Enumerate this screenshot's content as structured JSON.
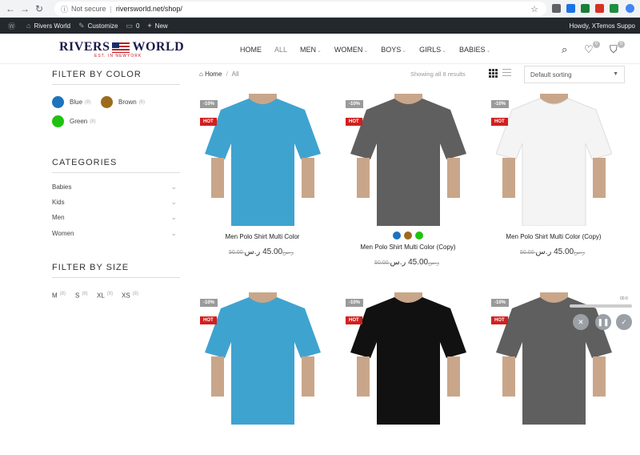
{
  "browser": {
    "not_secure": "Not secure",
    "url": "riversworld.net/shop/"
  },
  "wpbar": {
    "site": "Rivers World",
    "customize": "Customize",
    "comments": "0",
    "new": "New",
    "howdy": "Howdy, XTemos Suppo"
  },
  "header": {
    "logo_left": "RIVERS",
    "logo_right": "WORLD",
    "logo_sub": "EST. IN NEWYORK",
    "nav": [
      "HOME",
      "ALL",
      "MEN",
      "WOMEN",
      "BOYS",
      "GIRLS",
      "BABIES"
    ],
    "wishlist_count": "0",
    "cart_count": "0"
  },
  "sidebar": {
    "color_title": "FILTER BY COLOR",
    "colors": [
      {
        "name": "Blue",
        "count": "(8)",
        "hex": "#1e73be"
      },
      {
        "name": "Brown",
        "count": "(6)",
        "hex": "#9c6b1e"
      },
      {
        "name": "Green",
        "count": "(8)",
        "hex": "#20c20e"
      }
    ],
    "cat_title": "CATEGORIES",
    "categories": [
      "Babies",
      "Kids",
      "Men",
      "Women"
    ],
    "size_title": "FILTER BY SIZE",
    "sizes": [
      {
        "name": "M",
        "count": "(8)"
      },
      {
        "name": "S",
        "count": "(8)"
      },
      {
        "name": "XL",
        "count": "(8)"
      },
      {
        "name": "XS",
        "count": "(8)"
      }
    ]
  },
  "toolbar": {
    "home": "Home",
    "sep": "/",
    "current": "All",
    "showing": "Showing all 8 results",
    "sort": "Default sorting"
  },
  "products": [
    {
      "name": "Men Polo Shirt Multi Color",
      "sale": "-10%",
      "hot": "HOT",
      "old_price": "50.00 ر.س",
      "price": "45.00 ر.س",
      "shirt_color": "#3fa3d0",
      "swatches": []
    },
    {
      "name": "Men Polo Shirt Multi Color (Copy)",
      "sale": "-10%",
      "hot": "HOT",
      "old_price": "50.00 ر.س",
      "price": "45.00 ر.س",
      "shirt_color": "#5f5f5f",
      "swatches": [
        "#1e73be",
        "#9c6b1e",
        "#20c20e"
      ]
    },
    {
      "name": "Men Polo Shirt Multi Color (Copy)",
      "sale": "-10%",
      "hot": "HOT",
      "old_price": "50.00 ر.س",
      "price": "45.00 ر.س",
      "shirt_color": "#f4f4f4",
      "swatches": []
    },
    {
      "name": "",
      "sale": "-10%",
      "hot": "HOT",
      "old_price": "",
      "price": "",
      "shirt_color": "#3fa3d0",
      "swatches": []
    },
    {
      "name": "",
      "sale": "-10%",
      "hot": "HOT",
      "old_price": "",
      "price": "",
      "shirt_color": "#111111",
      "swatches": []
    },
    {
      "name": "",
      "sale": "-10%",
      "hot": "HOT",
      "old_price": "",
      "price": "",
      "shirt_color": "#5f5f5f",
      "swatches": []
    }
  ],
  "video": {
    "time": "00:0"
  }
}
